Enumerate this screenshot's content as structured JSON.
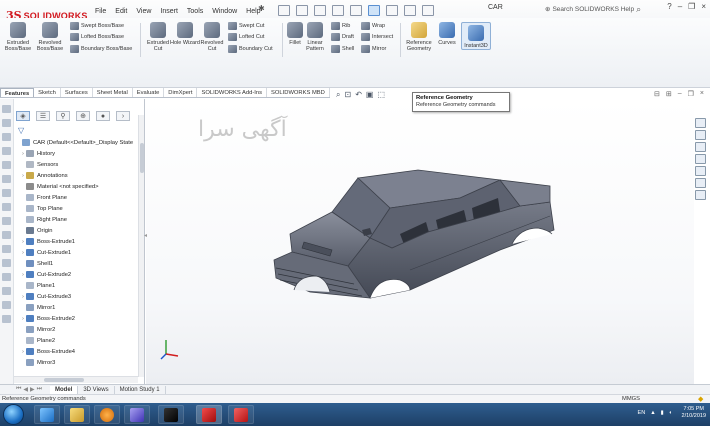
{
  "app": {
    "logo_prefix": "3S",
    "logo_name": "SOLIDWORKS",
    "document_title": "CAR",
    "search_placeholder": "Search SOLIDWORKS Help",
    "help_label": "?",
    "menu": [
      "File",
      "Edit",
      "View",
      "Insert",
      "Tools",
      "Window",
      "Help"
    ]
  },
  "ribbon": {
    "extruded_boss": "Extruded Boss/Base",
    "revolved_boss": "Revolved Boss/Base",
    "swept_boss": "Swept Boss/Base",
    "lofted_boss": "Lofted Boss/Base",
    "boundary_boss": "Boundary Boss/Base",
    "extruded_cut": "Extruded Cut",
    "hole_wizard": "Hole Wizard",
    "revolved_cut": "Revolved Cut",
    "swept_cut": "Swept Cut",
    "lofted_cut": "Lofted Cut",
    "boundary_cut": "Boundary Cut",
    "fillet": "Fillet",
    "linear_pattern": "Linear Pattern",
    "rib": "Rib",
    "draft": "Draft",
    "shell": "Shell",
    "wrap": "Wrap",
    "intersect": "Intersect",
    "mirror": "Mirror",
    "reference_geometry": "Reference Geometry",
    "curves": "Curves",
    "instant3d": "Instant3D"
  },
  "tabs": [
    "Features",
    "Sketch",
    "Surfaces",
    "Sheet Metal",
    "Evaluate",
    "DimXpert",
    "SOLIDWORKS Add-Ins",
    "SOLIDWORKS MBD"
  ],
  "tooltip": {
    "title": "Reference Geometry",
    "description": "Reference Geometry commands"
  },
  "watermark": "آگهی سرا",
  "tree": [
    {
      "label": "CAR  (Default<<Default>_Display State",
      "level": 0,
      "icon": "part-icon",
      "expand": ""
    },
    {
      "label": "History",
      "level": 1,
      "icon": "history-icon",
      "expand": "›"
    },
    {
      "label": "Sensors",
      "level": 1,
      "icon": "sensors-icon",
      "expand": ""
    },
    {
      "label": "Annotations",
      "level": 1,
      "icon": "annotations-icon",
      "expand": "›"
    },
    {
      "label": "Material <not specified>",
      "level": 1,
      "icon": "material-icon",
      "expand": ""
    },
    {
      "label": "Front Plane",
      "level": 1,
      "icon": "plane-icon",
      "expand": ""
    },
    {
      "label": "Top Plane",
      "level": 1,
      "icon": "plane-icon",
      "expand": ""
    },
    {
      "label": "Right Plane",
      "level": 1,
      "icon": "plane-icon",
      "expand": ""
    },
    {
      "label": "Origin",
      "level": 1,
      "icon": "origin-icon",
      "expand": ""
    },
    {
      "label": "Boss-Extrude1",
      "level": 1,
      "icon": "boss-extrude-icon",
      "expand": "›"
    },
    {
      "label": "Cut-Extrude1",
      "level": 1,
      "icon": "cut-extrude-icon",
      "expand": "›"
    },
    {
      "label": "Shell1",
      "level": 1,
      "icon": "shell-icon",
      "expand": ""
    },
    {
      "label": "Cut-Extrude2",
      "level": 1,
      "icon": "cut-extrude-icon",
      "expand": "›"
    },
    {
      "label": "Plane1",
      "level": 1,
      "icon": "plane-icon",
      "expand": ""
    },
    {
      "label": "Cut-Extrude3",
      "level": 1,
      "icon": "cut-extrude-icon",
      "expand": "›"
    },
    {
      "label": "Mirror1",
      "level": 1,
      "icon": "mirror-icon",
      "expand": ""
    },
    {
      "label": "Boss-Extrude2",
      "level": 1,
      "icon": "boss-extrude-icon",
      "expand": "›"
    },
    {
      "label": "Mirror2",
      "level": 1,
      "icon": "mirror-icon",
      "expand": ""
    },
    {
      "label": "Plane2",
      "level": 1,
      "icon": "plane-icon",
      "expand": ""
    },
    {
      "label": "Boss-Extrude4",
      "level": 1,
      "icon": "boss-extrude-icon",
      "expand": "›"
    },
    {
      "label": "Mirror3",
      "level": 1,
      "icon": "mirror-icon",
      "expand": ""
    }
  ],
  "bottom_tabs": [
    "Model",
    "3D Views",
    "Motion Study 1"
  ],
  "status": {
    "text": "Reference Geometry commands",
    "units": "MMGS"
  },
  "taskbar": {
    "time": "7:05 PM",
    "date": "2/10/2019",
    "lang": "EN"
  }
}
